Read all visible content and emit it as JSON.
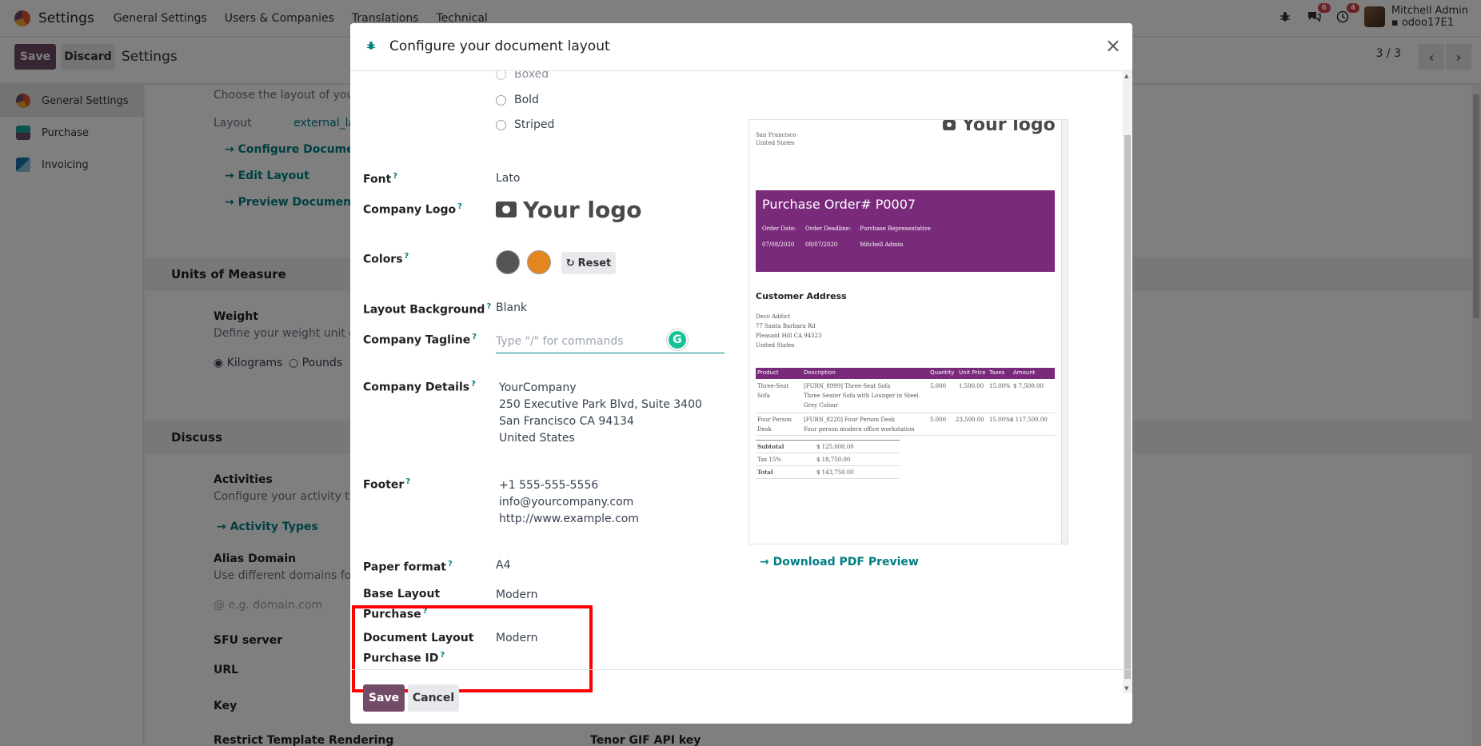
{
  "topnav": {
    "brand": "Settings",
    "menus": [
      "General Settings",
      "Users & Companies",
      "Translations",
      "Technical"
    ],
    "chat_badge": "6",
    "activity_badge": "4",
    "user_name": "Mitchell Admin",
    "user_db": "odoo17E1"
  },
  "controlbar": {
    "save": "Save",
    "discard": "Discard",
    "title": "Settings",
    "pager": "3 / 3"
  },
  "sidebar": {
    "items": [
      {
        "label": "General Settings"
      },
      {
        "label": "Purchase"
      },
      {
        "label": "Invoicing"
      }
    ]
  },
  "background": {
    "choose_layout": "Choose the layout of your c",
    "layout_label": "Layout",
    "layout_value": "external_la",
    "configure_doc": "Configure Document",
    "edit_layout": "Edit Layout",
    "preview_doc": "Preview Document",
    "uom_heading": "Units of Measure",
    "weight": "Weight",
    "weight_desc": "Define your weight unit of",
    "kilograms": "Kilograms",
    "pounds": "Pounds",
    "discuss_heading": "Discuss",
    "activities": "Activities",
    "activities_desc": "Configure your activity type",
    "activity_types": "Activity Types",
    "alias_domain": "Alias Domain",
    "alias_desc": "Use different domains for y",
    "alias_placeholder": "@ e.g. domain.com",
    "sfu": "SFU server",
    "url": "URL",
    "key": "Key",
    "restrict": "Restrict Template Rendering",
    "tenor": "Tenor GIF API key"
  },
  "modal": {
    "title": "Configure your document layout",
    "close": "×",
    "radio_boxed": "Boxed",
    "radio_bold": "Bold",
    "radio_striped": "Striped",
    "font_label": "Font",
    "font_value": "Lato",
    "logo_label": "Company Logo",
    "logo_text": "Your logo",
    "colors_label": "Colors",
    "color1": "#555555",
    "color2": "#e4861f",
    "reset": "Reset",
    "bg_label": "Layout Background",
    "bg_value": "Blank",
    "tagline_label": "Company Tagline",
    "tagline_placeholder": "Type \"/\" for commands",
    "details_label": "Company Details",
    "details": [
      "YourCompany",
      "250 Executive Park Blvd, Suite 3400",
      "San Francisco CA 94134",
      "United States"
    ],
    "footer_label": "Footer",
    "footer": [
      "+1 555-555-5556",
      "info@yourcompany.com",
      "http://www.example.com"
    ],
    "paper_label": "Paper format",
    "paper_value": "A4",
    "base_layout_label_1": "Base Layout",
    "base_layout_label_2": "Purchase",
    "base_layout_value": "Modern",
    "doc_layout_label_1": "Document Layout",
    "doc_layout_label_2": "Purchase ID",
    "doc_layout_value": "Modern",
    "download": "Download PDF Preview",
    "save": "Save",
    "cancel": "Cancel"
  },
  "preview": {
    "logo": "Your logo",
    "addr1": "San Francisco",
    "addr2": "United States",
    "title": "Purchase Order# P0007",
    "order_date_label": "Order Date:",
    "deadline_label": "Order Deadline:",
    "rep_label": "Purchase Representative",
    "order_date": "07/08/2020",
    "deadline": "08/07/2020",
    "rep": "Mitchell Admin",
    "customer_heading": "Customer Address",
    "customer": [
      "Deco Addict",
      "77 Santa Barbara Rd",
      "Pleasant Hill CA 94523",
      "United States"
    ],
    "headers": [
      "Product",
      "Description",
      "Quantity",
      "Unit Price",
      "Taxes",
      "Amount"
    ],
    "row1": [
      "Three-Seat",
      "Sofa",
      "[FURN_8999] Three-Seat Sofa",
      "Three Seater Sofa with Lounger in Steel",
      "Grey Colour",
      "5.000",
      "1,500.00",
      "15.00%",
      "$ 7,500.00"
    ],
    "row2": [
      "Four Person",
      "Desk",
      "[FURN_8220] Four Person Desk",
      "Four person modern office workstation",
      "5.000",
      "23,500.00",
      "15.00%",
      "$ 117,500.00"
    ],
    "subtotal_label": "Subtotal",
    "subtotal": "$ 125,000.00",
    "tax_label": "Tax 15%",
    "tax": "$ 18,750.00",
    "total_label": "Total",
    "total": "$ 143,750.00"
  }
}
